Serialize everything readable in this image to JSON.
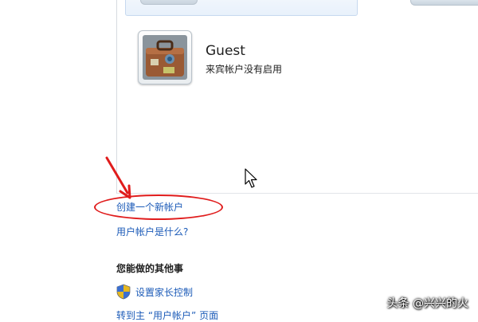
{
  "accounts": {
    "guest": {
      "name": "Guest",
      "status": "来宾帐户没有启用"
    }
  },
  "links": {
    "create_account": "创建一个新帐户",
    "what_is_account": "用户帐户是什么?"
  },
  "other_tasks": {
    "heading": "您能做的其他事",
    "parental_controls": "设置家长控制",
    "goto_user_accounts": "转到主 “用户帐户” 页面"
  },
  "annotation": {
    "color": "#e01c1c"
  },
  "watermark": "头条 @兴兴的火",
  "colors": {
    "link": "#1c5bb8",
    "text": "#1e1e1e"
  }
}
